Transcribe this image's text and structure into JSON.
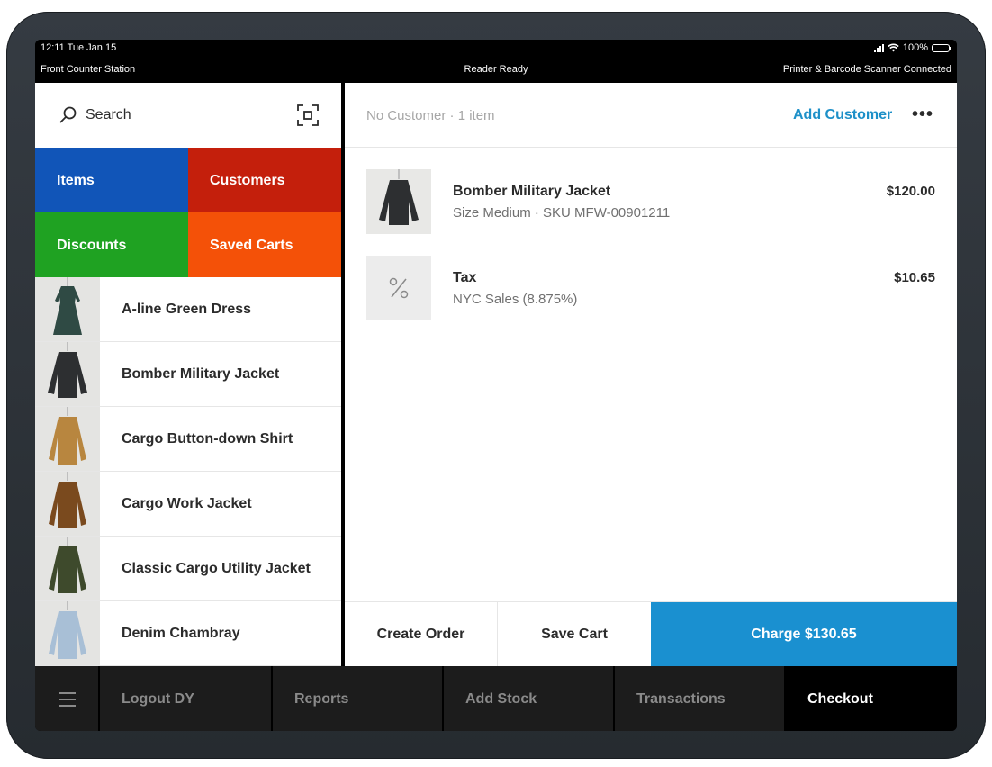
{
  "status_bar": {
    "time": "12:11  Tue Jan 15",
    "battery": "100%",
    "station": "Front Counter Station",
    "reader": "Reader Ready",
    "devices": "Printer & Barcode Scanner Connected"
  },
  "search": {
    "label": "Search"
  },
  "tiles": [
    {
      "label": "Items",
      "color": "#1155b8"
    },
    {
      "label": "Customers",
      "color": "#c41f0c"
    },
    {
      "label": "Discounts",
      "color": "#1fa222"
    },
    {
      "label": "Saved Carts",
      "color": "#f45108"
    }
  ],
  "items": [
    {
      "name": "A-line Green Dress",
      "icon": "dress-thumbnail"
    },
    {
      "name": "Bomber Military Jacket",
      "icon": "jacket-thumbnail"
    },
    {
      "name": "Cargo Button-down Shirt",
      "icon": "shirt-thumbnail"
    },
    {
      "name": "Cargo Work Jacket",
      "icon": "jacket-thumbnail"
    },
    {
      "name": "Classic Cargo Utility Jacket",
      "icon": "jacket-thumbnail"
    },
    {
      "name": "Denim Chambray",
      "icon": "shirt-thumbnail"
    }
  ],
  "cart": {
    "customer_status": "No Customer · 1 item",
    "add_customer": "Add Customer",
    "more": "•••",
    "lines": [
      {
        "title": "Bomber Military Jacket",
        "sub": "Size Medium · SKU MFW-00901211",
        "price": "$120.00"
      },
      {
        "title": "Tax",
        "sub": "NYC Sales (8.875%)",
        "price": "$10.65"
      }
    ],
    "create_order": "Create Order",
    "save_cart": "Save Cart",
    "charge": "Charge $130.65"
  },
  "nav": {
    "logout": "Logout DY",
    "reports": "Reports",
    "add_stock": "Add Stock",
    "transactions": "Transactions",
    "checkout": "Checkout"
  }
}
